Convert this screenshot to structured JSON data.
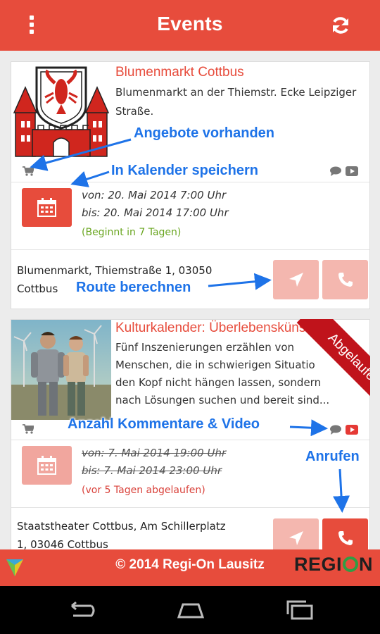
{
  "app_bar": {
    "title": "Events",
    "menu_icon": "overflow-menu-icon",
    "refresh_icon": "refresh-icon",
    "color": "#e74c3c"
  },
  "events": [
    {
      "title": "Blumenmarkt Cottbus",
      "description": "Blumenmarkt an der Thiemstr. Ecke Leipziger Straße.",
      "from": "von: 20. Mai 2014 7:00 Uhr",
      "to": "bis: 20. Mai 2014 17:00 Uhr",
      "status": "(Beginnt in 7 Tagen)",
      "status_color": "#6aa621",
      "address_line1": "Blumenmarkt, Thiemstraße 1, 03050",
      "address_line2": "Cottbus",
      "icons": [
        "shopping-cart-icon",
        "comment-icon",
        "video-icon",
        "calendar-icon",
        "navigation-icon",
        "phone-icon"
      ]
    },
    {
      "title": "Kulturkalender: Überlebenskünst",
      "description_lines": [
        "Fünf Inszenierungen erzählen von",
        "Menschen, die in schwierigen Situatio",
        "den Kopf nicht hängen lassen, sondern",
        "nach Lösungen suchen und bereit sind..."
      ],
      "ribbon": "Abgelaufen",
      "from": "von: 7. Mai 2014 19:00 Uhr",
      "to": "bis: 7. Mai 2014 23:00 Uhr",
      "status": "(vor 5 Tagen abgelaufen)",
      "status_color": "#d9413a",
      "address_line1": "Staatstheater Cottbus, Am Schillerplatz",
      "address_line2": "1, 03046 Cottbus",
      "icons": [
        "shopping-cart-icon",
        "comment-icon",
        "video-icon",
        "calendar-icon",
        "navigation-icon",
        "phone-icon"
      ]
    }
  ],
  "annotations": {
    "offers": "Angebote vorhanden",
    "calendar": "In Kalender speichern",
    "route": "Route berechnen",
    "comments_video": "Anzahl Kommentare & Video",
    "call": "Anrufen"
  },
  "footer": {
    "copyright": "© 2014 Regi-On Lausitz",
    "brand_pre": "REGI",
    "brand_post": "N"
  },
  "system_nav": [
    "back-icon",
    "home-icon",
    "recents-icon"
  ]
}
